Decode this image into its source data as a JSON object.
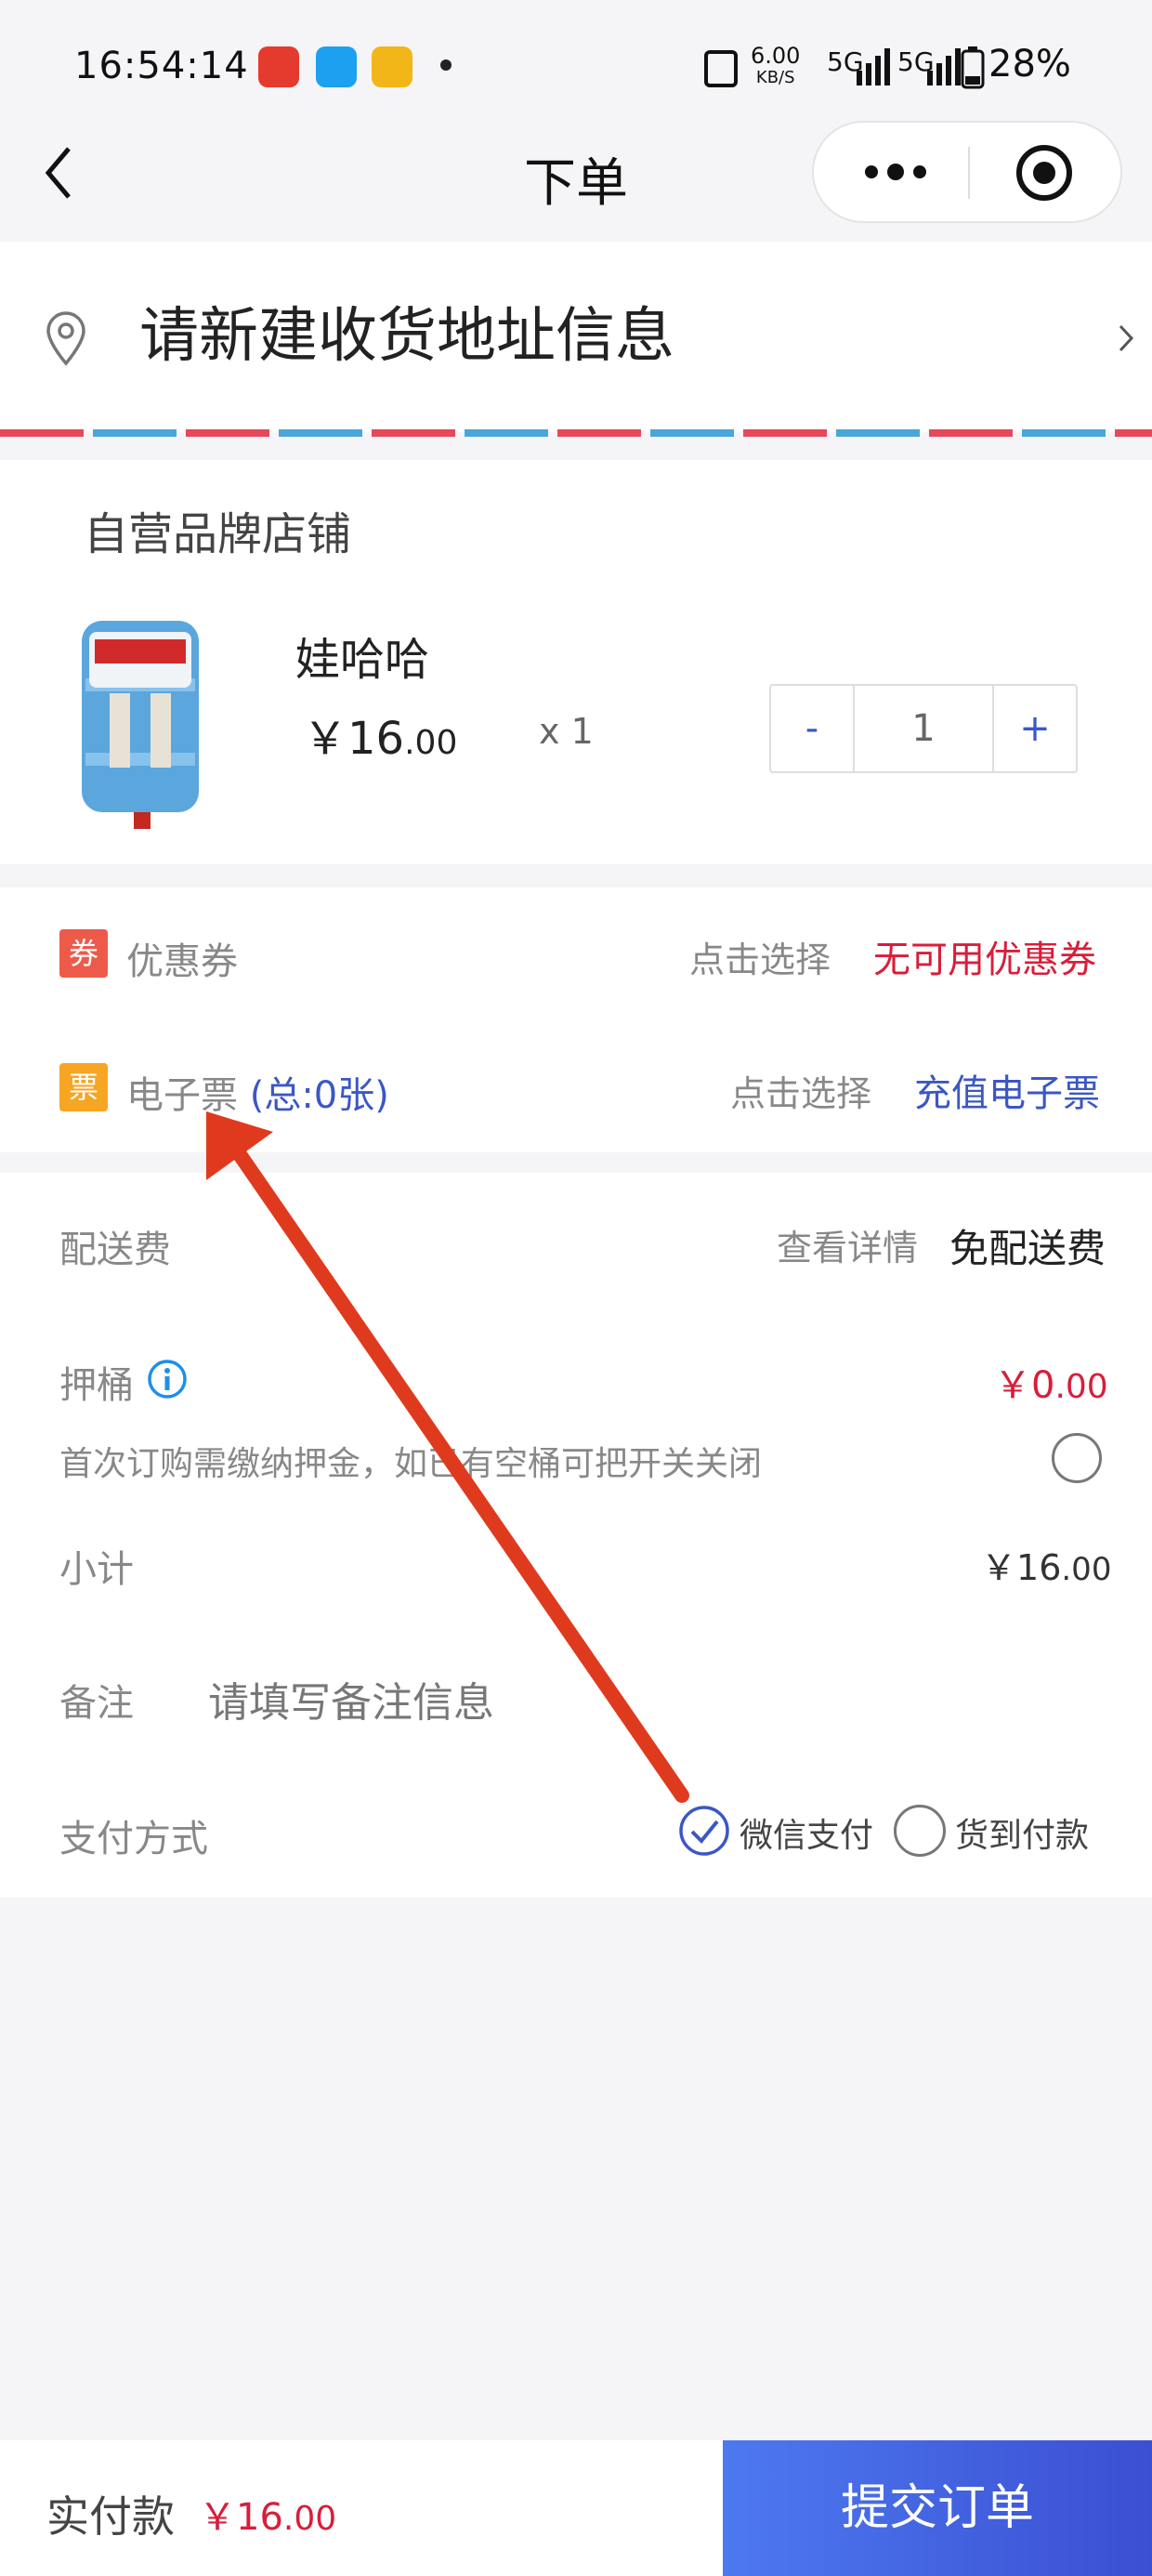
{
  "status_bar": {
    "time": "16:54:14",
    "network_speed": "6.00",
    "network_unit": "KB/S",
    "signal1": "5G",
    "signal2": "5G",
    "battery": "28%"
  },
  "nav": {
    "title": "下单"
  },
  "address": {
    "prompt": "请新建收货地址信息"
  },
  "shop": {
    "name": "自营品牌店铺"
  },
  "product": {
    "name": "娃哈哈",
    "price_currency": "￥",
    "price_int": "16",
    "price_dec": ".00",
    "qty_label": "x 1",
    "stepper_minus": "-",
    "stepper_value": "1",
    "stepper_plus": "+"
  },
  "coupon": {
    "badge": "券",
    "label": "优惠券",
    "hint": "点击选择",
    "action": "无可用优惠券"
  },
  "eticket": {
    "badge": "票",
    "label": "电子票",
    "count": "(总:0张)",
    "hint": "点击选择",
    "action": "充值电子票"
  },
  "delivery": {
    "label": "配送费",
    "hint": "查看详情",
    "value": "免配送费"
  },
  "deposit": {
    "label": "押桶",
    "value_currency": "￥",
    "value_int": "0",
    "value_dec": ".00",
    "note": "首次订购需缴纳押金，如已有空桶可把开关关闭"
  },
  "subtotal": {
    "label": "小计",
    "currency": "￥",
    "int": "16",
    "dec": ".00"
  },
  "remark": {
    "label": "备注",
    "placeholder": "请填写备注信息"
  },
  "payment": {
    "label": "支付方式",
    "option1": "微信支付",
    "option2": "货到付款",
    "selected": "微信支付"
  },
  "footer": {
    "total_label": "实付款",
    "currency": "￥",
    "int": "16",
    "dec": ".00",
    "submit": "提交订单"
  },
  "colors": {
    "accent_blue": "#3b57c4",
    "accent_red": "#d81e3a",
    "coupon_badge": "#ee5a4a",
    "ticket_badge": "#f6a623",
    "arrow": "#e03a1e"
  },
  "icons": {
    "back": "chevron-left-icon",
    "more": "more-dots-icon",
    "target": "target-icon",
    "location": "location-pin-icon",
    "info": "info-icon",
    "chevron": "chevron-right-icon",
    "check": "check-circle-icon"
  }
}
